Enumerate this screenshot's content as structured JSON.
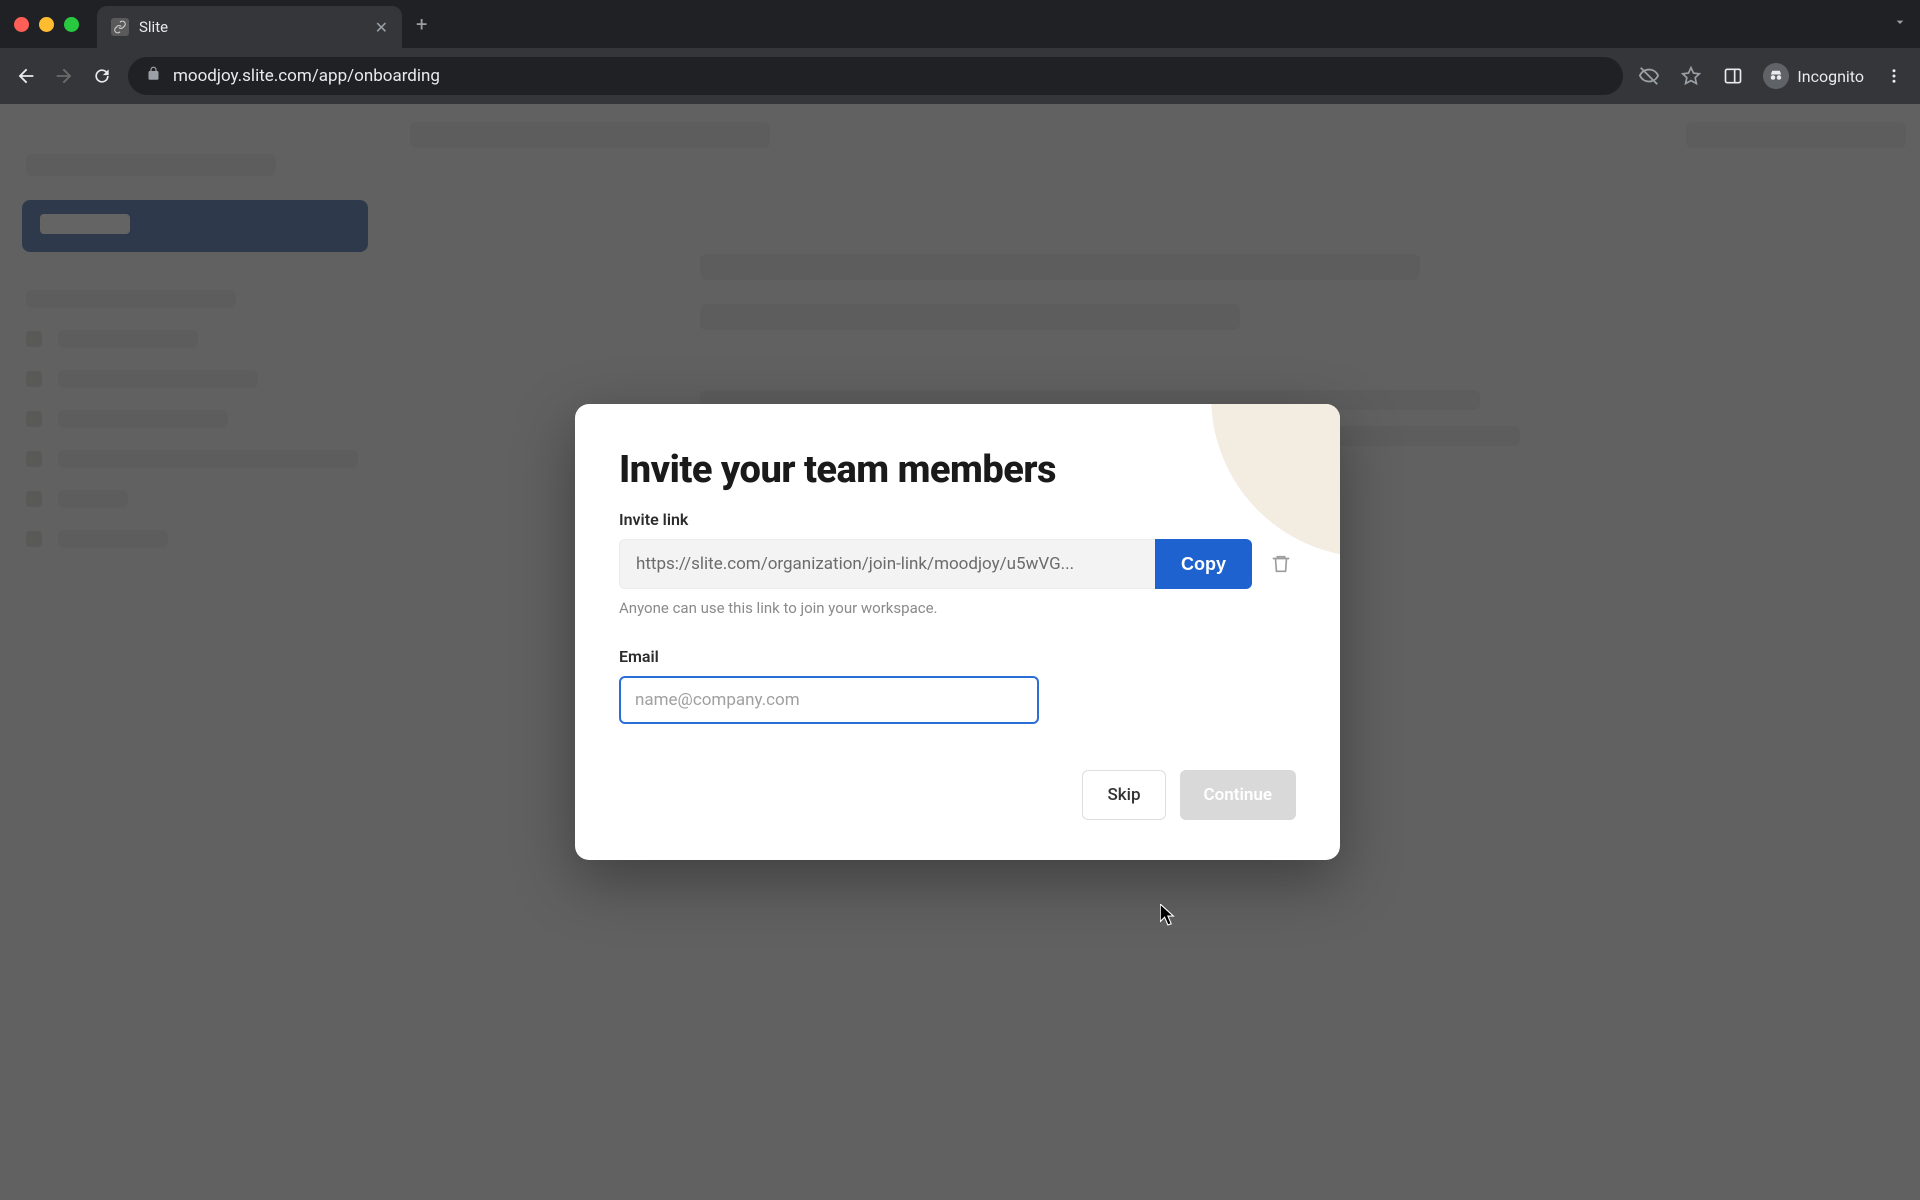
{
  "browser": {
    "tab_title": "Slite",
    "url": "moodjoy.slite.com/app/onboarding",
    "incognito_label": "Incognito"
  },
  "modal": {
    "title": "Invite your team members",
    "invite_link_label": "Invite link",
    "invite_link_value": "https://slite.com/organization/join-link/moodjoy/u5wVG...",
    "copy_label": "Copy",
    "hint": "Anyone can use this link to join your workspace.",
    "email_label": "Email",
    "email_placeholder": "name@company.com",
    "email_value": "",
    "skip_label": "Skip",
    "continue_label": "Continue"
  }
}
